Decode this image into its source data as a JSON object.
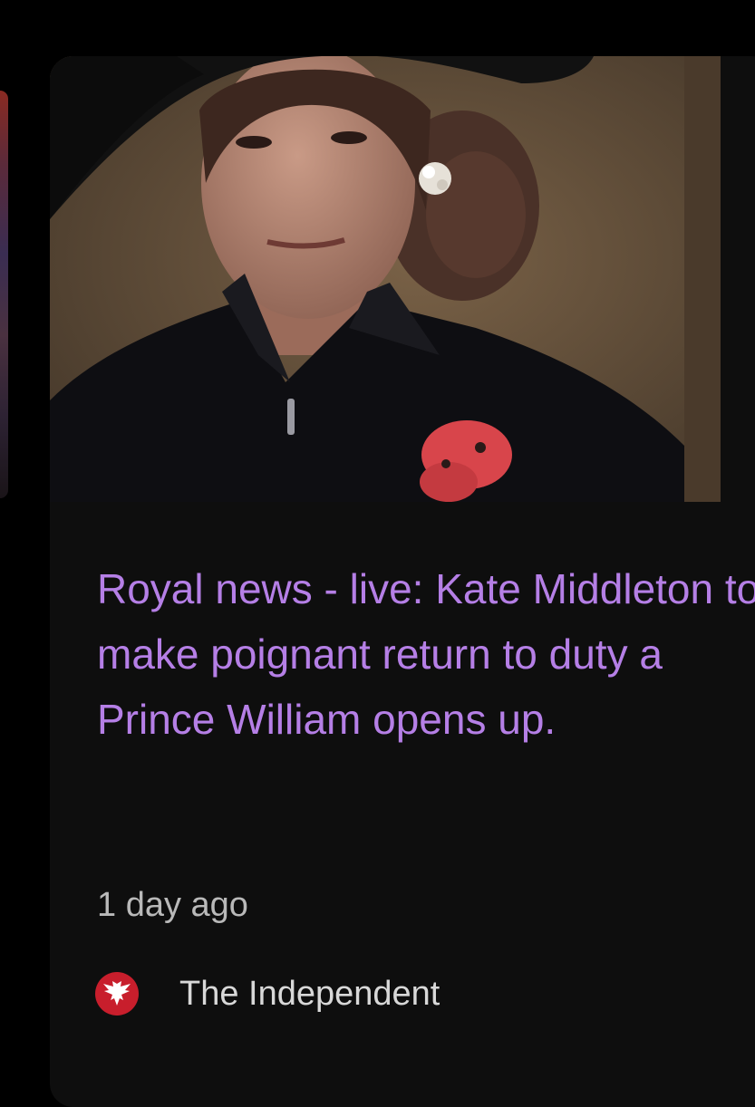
{
  "article": {
    "headline": "Royal news - live: Kate Middleton to make poignant return to duty a Prince William opens up.",
    "time": "1 day ago",
    "source": {
      "name": "The Independent",
      "logo_icon": "independent-eagle-logo"
    },
    "thumbnail_icon": "article-photo"
  },
  "colors": {
    "headline": "#b57fe6",
    "time": "#b9b9b9",
    "source": "#d8d8d8",
    "card_bg": "#0e0e0e",
    "page_bg": "#000000",
    "logo_red": "#c81e2c"
  }
}
